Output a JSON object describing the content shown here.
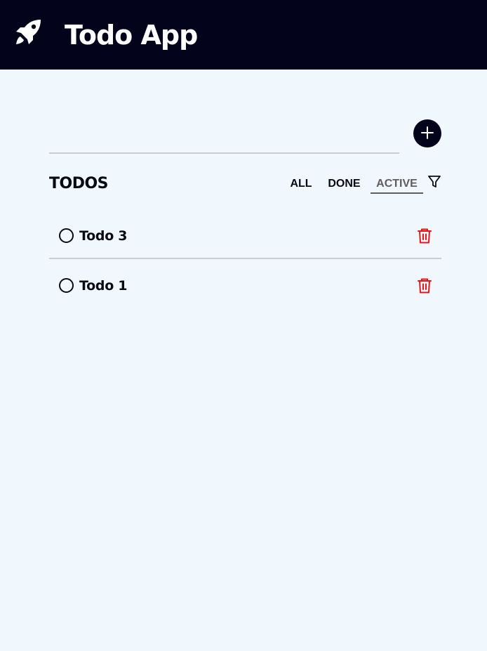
{
  "header": {
    "title": "Todo App",
    "logo_icon": "rocket-icon"
  },
  "new_todo": {
    "value": "",
    "placeholder": "",
    "add_icon": "plus-icon"
  },
  "list": {
    "heading": "TODOS",
    "filters": [
      {
        "label": "ALL",
        "selected": false
      },
      {
        "label": "DONE",
        "selected": false
      },
      {
        "label": "ACTIVE",
        "selected": true
      }
    ],
    "filter_icon": "funnel-icon",
    "items": [
      {
        "text": "Todo 3",
        "done": false
      },
      {
        "text": "Todo 1",
        "done": false
      }
    ]
  },
  "colors": {
    "header_bg": "#03031b",
    "page_bg": "#f0f7fd",
    "delete": "#e8141a",
    "active_filter": "#615d5d"
  }
}
